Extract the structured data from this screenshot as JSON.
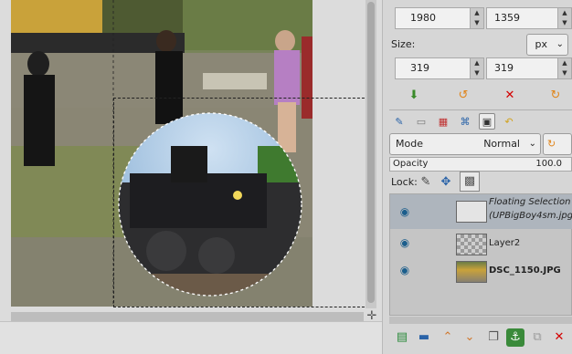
{
  "position": {
    "x": "1980",
    "y": "1359"
  },
  "size": {
    "label": "Size:",
    "unit": "px",
    "width": "319",
    "height": "319"
  },
  "layers_panel": {
    "mode_label": "Mode",
    "mode_value": "Normal",
    "opacity_label": "Opacity",
    "opacity_value": "100.0",
    "lock_label": "Lock:",
    "layers": [
      {
        "name_line1": "Floating Selection",
        "name_line2": "(UPBigBoy4sm.jpg"
      },
      {
        "name": "Layer2"
      },
      {
        "name": "DSC_1150.JPG"
      }
    ]
  },
  "colors": {
    "accent": "#1b5e8c",
    "selected_row": "#aeb5bd",
    "red": "#d40000"
  }
}
